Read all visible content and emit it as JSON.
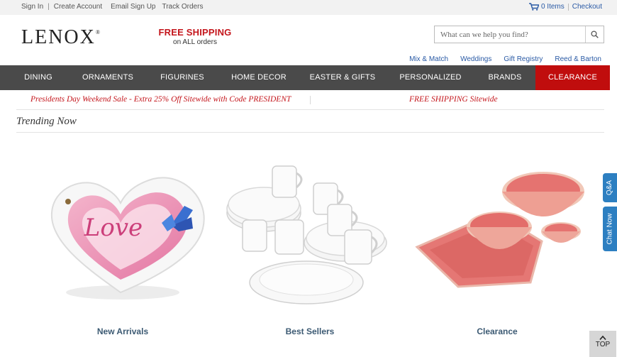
{
  "utility": {
    "sign_in": "Sign In",
    "create_account": "Create Account",
    "email_signup": "Email Sign Up",
    "track_orders": "Track Orders",
    "items": "0 Items",
    "checkout": "Checkout"
  },
  "brand": {
    "logo": "LENOX",
    "trademark": "®"
  },
  "promo": {
    "headline": "FREE SHIPPING",
    "sub": "on ALL orders"
  },
  "search": {
    "placeholder": "What can we help you find?"
  },
  "sublinks": [
    "Mix & Match",
    "Weddings",
    "Gift Registry",
    "Reed & Barton"
  ],
  "nav": [
    "DINING",
    "ORNAMENTS",
    "FIGURINES",
    "HOME DECOR",
    "EASTER & GIFTS",
    "PERSONALIZED",
    "BRANDS",
    "CLEARANCE"
  ],
  "strip": {
    "sale": "Presidents Day Weekend Sale - Extra 25% Off Sitewide with Code PRESIDENT",
    "shipping": "FREE SHIPPING Sitewide"
  },
  "section_title": "Trending Now",
  "products": [
    {
      "label": "New Arrivals",
      "image_text": "Love"
    },
    {
      "label": "Best Sellers"
    },
    {
      "label": "Clearance"
    }
  ],
  "side_tabs": {
    "qa": "Q&A",
    "chat": "Chat Now"
  },
  "top_button": "TOP",
  "colors": {
    "accent_red": "#c4161c",
    "nav_bg": "#4a4a4a",
    "clearance_bg": "#c00d0d",
    "link_blue": "#2a5aa5",
    "side_tab": "#2d7fc1"
  }
}
